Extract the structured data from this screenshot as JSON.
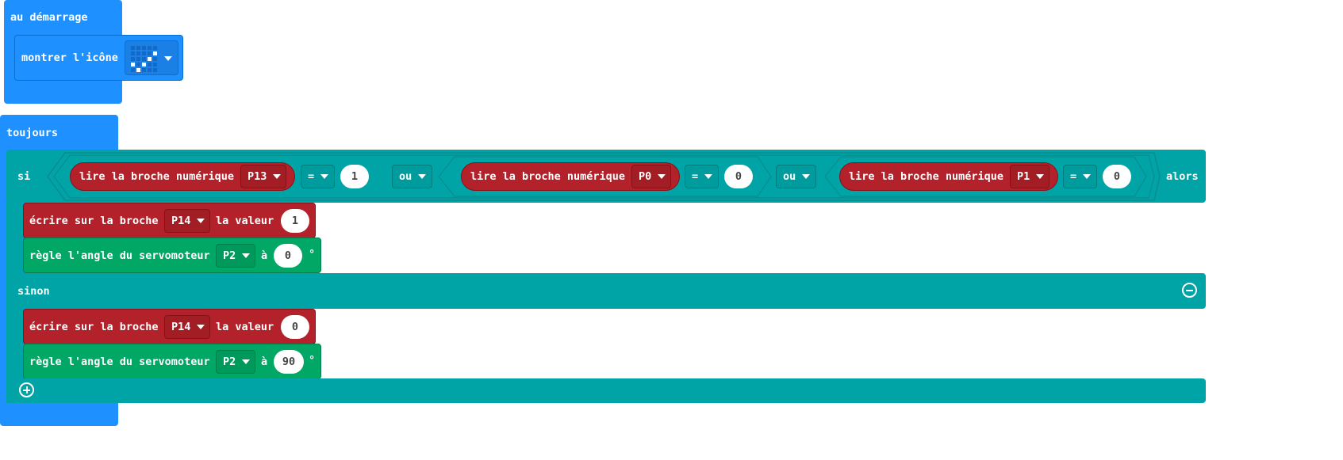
{
  "on_start": {
    "hat_label": "au démarrage",
    "show_icon_label": "montrer l'icône",
    "icon_leds": [
      [
        0,
        0,
        0,
        0,
        0
      ],
      [
        0,
        0,
        0,
        0,
        1
      ],
      [
        0,
        0,
        0,
        1,
        0
      ],
      [
        1,
        0,
        1,
        0,
        0
      ],
      [
        0,
        1,
        0,
        0,
        0
      ]
    ]
  },
  "forever": {
    "hat_label": "toujours",
    "if_label": "si",
    "then_label": "alors",
    "else_label": "sinon",
    "conditions": [
      {
        "read_label": "lire la broche numérique",
        "pin": "P13",
        "op": "=",
        "value": "1"
      },
      {
        "read_label": "lire la broche numérique",
        "pin": "P0",
        "op": "=",
        "value": "0"
      },
      {
        "read_label": "lire la broche numérique",
        "pin": "P1",
        "op": "=",
        "value": "0"
      }
    ],
    "or_label": "ou",
    "then_blocks": {
      "write": {
        "label": "écrire sur la broche",
        "pin": "P14",
        "value_label": "la valeur",
        "value": "1"
      },
      "servo": {
        "label": "règle l'angle du servomoteur",
        "pin": "P2",
        "at_label": "à",
        "value": "0",
        "unit": "°"
      }
    },
    "else_blocks": {
      "write": {
        "label": "écrire sur la broche",
        "pin": "P14",
        "value_label": "la valeur",
        "value": "0"
      },
      "servo": {
        "label": "règle l'angle du servomoteur",
        "pin": "P2",
        "at_label": "à",
        "value": "90",
        "unit": "°"
      }
    }
  }
}
